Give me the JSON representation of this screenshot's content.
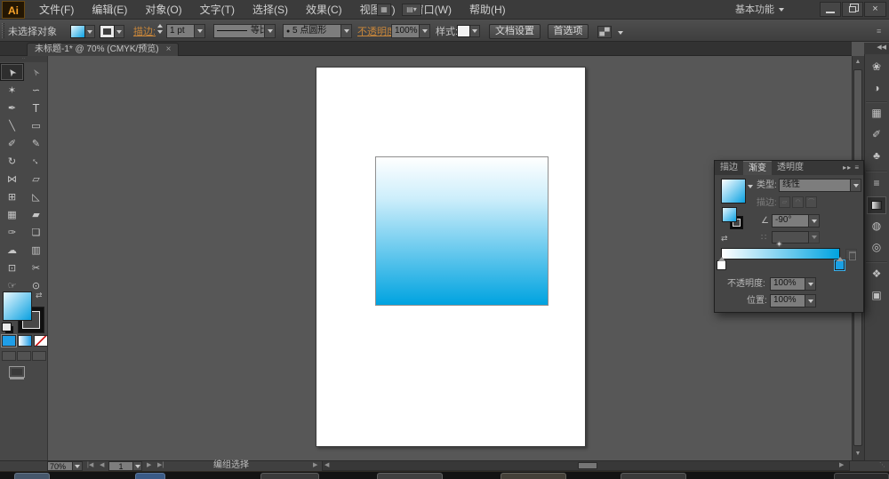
{
  "menubar": {
    "logo": "Ai",
    "items": [
      {
        "label": "文件(F)"
      },
      {
        "label": "编辑(E)"
      },
      {
        "label": "对象(O)"
      },
      {
        "label": "文字(T)"
      },
      {
        "label": "选择(S)"
      },
      {
        "label": "效果(C)"
      },
      {
        "label": "视图(V)"
      },
      {
        "label": "窗口(W)"
      },
      {
        "label": "帮助(H)"
      }
    ],
    "workspace": "基本功能",
    "close_glyph": "×"
  },
  "control_bar": {
    "no_selection": "未选择对象",
    "stroke_link": "描边:",
    "stroke_weight": "1 pt",
    "profile": "等比",
    "brush_dot": "●",
    "brush": "5 点圆形",
    "opacity_link": "不透明度:",
    "opacity_value": "100%",
    "style_label": "样式:",
    "document_setup": "文档设置",
    "preferences": "首选项",
    "flyout_menu": "≡"
  },
  "document_tab": {
    "title": "未标题-1* @ 70% (CMYK/预览)",
    "close": "×"
  },
  "toolbar": {
    "tools": [
      {
        "name": "selection-tool",
        "glyph": "➤"
      },
      {
        "name": "direct-selection-tool",
        "glyph": "➢"
      },
      {
        "name": "magic-wand-tool",
        "glyph": "✶"
      },
      {
        "name": "lasso-tool",
        "glyph": "∽"
      },
      {
        "name": "pen-tool",
        "glyph": "✒"
      },
      {
        "name": "type-tool",
        "glyph": "T"
      },
      {
        "name": "line-segment-tool",
        "glyph": "╲"
      },
      {
        "name": "rectangle-tool",
        "glyph": "▭"
      },
      {
        "name": "paintbrush-tool",
        "glyph": "✐"
      },
      {
        "name": "pencil-tool",
        "glyph": "✎"
      },
      {
        "name": "rotate-tool",
        "glyph": "↻"
      },
      {
        "name": "scale-tool",
        "glyph": "↔"
      },
      {
        "name": "width-tool",
        "glyph": "⋈"
      },
      {
        "name": "free-transform-tool",
        "glyph": "▱"
      },
      {
        "name": "shape-builder-tool",
        "glyph": "⊞"
      },
      {
        "name": "perspective-grid-tool",
        "glyph": "◺"
      },
      {
        "name": "mesh-tool",
        "glyph": "▦"
      },
      {
        "name": "gradient-tool",
        "glyph": "▰"
      },
      {
        "name": "eyedropper-tool",
        "glyph": "✑"
      },
      {
        "name": "blend-tool",
        "glyph": "❏"
      },
      {
        "name": "symbol-sprayer-tool",
        "glyph": "☁"
      },
      {
        "name": "column-graph-tool",
        "glyph": "▥"
      },
      {
        "name": "artboard-tool",
        "glyph": "⊡"
      },
      {
        "name": "slice-tool",
        "glyph": "✂"
      },
      {
        "name": "hand-tool",
        "glyph": "☞"
      },
      {
        "name": "zoom-tool",
        "glyph": "⊙"
      }
    ]
  },
  "gradient_panel": {
    "tabs": [
      {
        "label": "描边"
      },
      {
        "label": "渐变"
      },
      {
        "label": "透明度"
      }
    ],
    "panel_arrows": "▸▸",
    "panel_menu": "≡",
    "type_label": "类型:",
    "type_value": "线性",
    "stroke_label": "描边:",
    "angle_symbol": "∠",
    "angle_value": "-90°",
    "reverse_glyph": "⇄",
    "ratio_glyph": "∷",
    "opacity_label": "不透明度:",
    "opacity_value": "100%",
    "location_label": "位置:",
    "location_value": "100%"
  },
  "dock": {
    "collapse": "◀◀",
    "icons": [
      {
        "name": "color-panel-icon",
        "glyph": "❀"
      },
      {
        "name": "color-guide-panel-icon",
        "glyph": "◑"
      },
      {
        "name": "swatches-panel-icon",
        "glyph": "▦"
      },
      {
        "name": "brushes-panel-icon",
        "glyph": "✐"
      },
      {
        "name": "symbols-panel-icon",
        "glyph": "♣"
      },
      {
        "name": "stroke-panel-icon",
        "glyph": "≡"
      },
      {
        "name": "gradient-panel-icon",
        "glyph": ""
      },
      {
        "name": "transparency-panel-icon",
        "glyph": "◍"
      },
      {
        "name": "appearance-panel-icon",
        "glyph": "◎"
      },
      {
        "name": "layers-panel-icon",
        "glyph": "❖"
      },
      {
        "name": "artboards-panel-icon",
        "glyph": "▣"
      }
    ]
  },
  "status_bar": {
    "zoom": "70%",
    "first": "|◀",
    "prev": "◀",
    "next": "▶",
    "last": "▶|",
    "artboard_number": "1",
    "mode": "编组选择",
    "mode_arrow": "▶",
    "scroll_left": "◀",
    "scroll_right": "▶",
    "grip": "⋱"
  },
  "canvas": {
    "gradient_top_color": "#ffffff",
    "gradient_bottom_color": "#00a3e0",
    "artboard_color": "#ffffff"
  },
  "colors": {
    "accent_blue": "#00a3e0",
    "link_orange": "#c9873b",
    "ui_dark": "#3b3b3b"
  }
}
